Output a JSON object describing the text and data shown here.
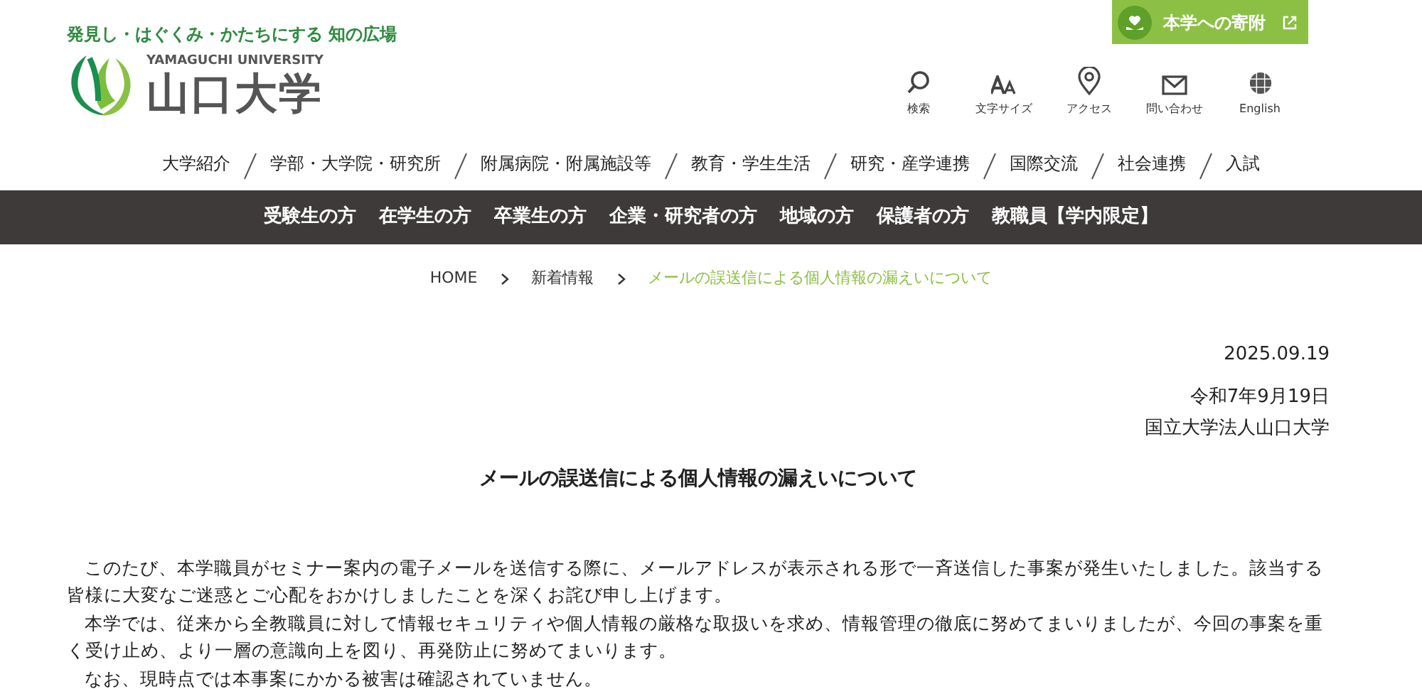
{
  "header": {
    "tagline": "発見し・はぐくみ・かたちにする 知の広場",
    "logo_en": "YAMAGUCHI UNIVERSITY",
    "logo_ja": "山口大学",
    "donate": {
      "label": "本学への寄附"
    },
    "tools": [
      {
        "kind": "search",
        "label": "検索"
      },
      {
        "kind": "font",
        "label": "文字サイズ"
      },
      {
        "kind": "access",
        "label": "アクセス"
      },
      {
        "kind": "mail",
        "label": "問い合わせ"
      },
      {
        "kind": "globe",
        "label": "English"
      }
    ]
  },
  "main_nav": [
    "大学紹介",
    "学部・大学院・研究所",
    "附属病院・附属施設等",
    "教育・学生生活",
    "研究・産学連携",
    "国際交流",
    "社会連携",
    "入試"
  ],
  "audience_nav": [
    "受験生の方",
    "在学生の方",
    "卒業生の方",
    "企業・研究者の方",
    "地域の方",
    "保護者の方",
    "教職員【学内限定】"
  ],
  "breadcrumb": [
    {
      "label": "HOME",
      "current": false
    },
    {
      "label": "新着情報",
      "current": false
    },
    {
      "label": "メールの誤送信による個人情報の漏えいについて",
      "current": true
    }
  ],
  "article": {
    "date": "2025.09.19",
    "issued": "令和7年9月19日",
    "issuer": "国立大学法人山口大学",
    "title": "メールの誤送信による個人情報の漏えいについて",
    "paragraphs": [
      "このたび、本学職員がセミナー案内の電子メールを送信する際に、メールアドレスが表示される形で一斉送信した事案が発生いたしました。該当する皆様に大変なご迷惑とご心配をおかけしましたことを深くお詫び申し上げます。",
      "本学では、従来から全教職員に対して情報セキュリティや個人情報の厳格な取扱いを求め、情報管理の徹底に努めてまいりましたが、今回の事案を重く受け止め、より一層の意識向上を図り、再発防止に努めてまいります。",
      "なお、現時点では本事案にかかる被害は確認されていません。"
    ]
  }
}
